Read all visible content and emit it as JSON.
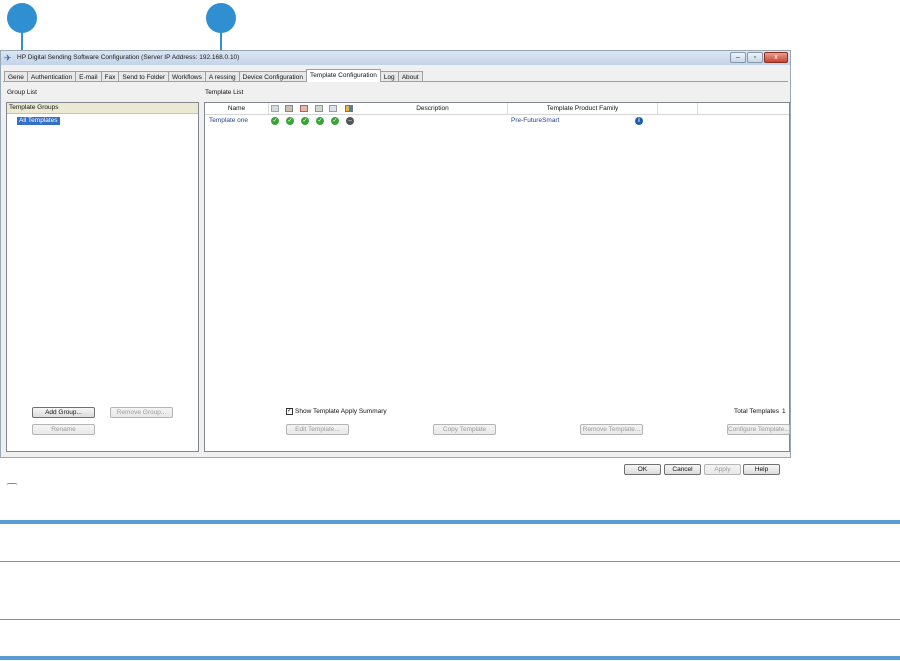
{
  "window": {
    "title": "HP Digital Sending Software Configuration (Server IP Address: 192.168.0.10)",
    "app_icon": "hp-logo-icon",
    "controls": [
      "–",
      "▫",
      "x"
    ]
  },
  "tabs": [
    {
      "label": "General",
      "visible": "Gene",
      "active": false
    },
    {
      "label": "Authentication",
      "active": false
    },
    {
      "label": "E-mail",
      "active": false
    },
    {
      "label": "Fax",
      "active": false
    },
    {
      "label": "Send to Folder",
      "active": false
    },
    {
      "label": "Workflows",
      "active": false
    },
    {
      "label": "Addressing",
      "visible": "A  ressing",
      "active": false
    },
    {
      "label": "Device Configuration",
      "active": false
    },
    {
      "label": "Template Configuration",
      "active": true
    },
    {
      "label": "Log",
      "active": false
    },
    {
      "label": "About",
      "active": false
    }
  ],
  "group_list": {
    "label": "Group List",
    "header": "Template Groups",
    "items": [
      "All Templates"
    ],
    "buttons": {
      "add": "Add Group...",
      "remove": "Remove Group...",
      "rename": "Rename"
    }
  },
  "template_list": {
    "label": "Template List",
    "columns": {
      "name": "Name",
      "description": "Description",
      "family": "Template Product Family"
    },
    "icon_columns": [
      "email-icon",
      "fax-icon",
      "folder-icon",
      "workflow-icon",
      "addressing-icon",
      "device-icon"
    ],
    "rows": [
      {
        "name": "Template one",
        "statuses": [
          "ok",
          "ok",
          "ok",
          "ok",
          "ok",
          "none"
        ],
        "description": "",
        "family": "Pre-FutureSmart"
      }
    ],
    "show_summary_label": "Show Template Apply Summary",
    "show_summary_checked": true,
    "total_label": "Total Templates",
    "total_count": "1",
    "buttons": {
      "edit": "Edit Template...",
      "copy": "Copy Template",
      "remove": "Remove Template...",
      "configure": "Configure Template..."
    }
  },
  "dialog_buttons": {
    "ok": "OK",
    "cancel": "Cancel",
    "apply": "Apply",
    "help": "Help"
  },
  "colors": {
    "callout": "#2f8fd0",
    "divider": "#5b9bd5",
    "selection": "#3370c6",
    "ok": "#3aa33a"
  }
}
